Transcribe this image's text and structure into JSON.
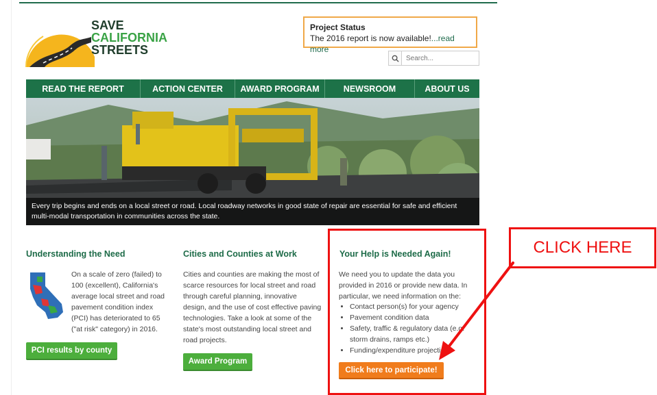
{
  "logo": {
    "line1": "SAVE",
    "line2": "CALIFORNIA",
    "line3": "STREETS"
  },
  "status": {
    "title": "Project Status",
    "text": "The 2016 report is now available!",
    "link": "...read more"
  },
  "search": {
    "placeholder": "Search..."
  },
  "nav": {
    "items": [
      "READ THE REPORT",
      "ACTION CENTER",
      "AWARD PROGRAM",
      "NEWSROOM",
      "ABOUT US"
    ]
  },
  "hero": {
    "caption": "Every trip begins and ends on a local street or road. Local roadway networks in good state of repair are essential for safe and efficient multi-modal transportation in communities across the state."
  },
  "need": {
    "title": "Understanding the Need",
    "text": "On a scale of zero (failed) to 100 (excellent), California's average local street and road pavement condition index (PCI) has deteriorated to 65 (\"at risk\" category) in 2016.",
    "button": "PCI results by county"
  },
  "cities": {
    "title": "Cities and Counties at Work",
    "text": "Cities and counties are making the most of scarce resources for local street and road through careful planning, innovative design, and the use of cost effective paving technologies. Take a look at some of the state's most outstanding local street and road projects.",
    "button": "Award Program"
  },
  "help": {
    "title": "Your Help is Needed Again!",
    "text": "We need you to update the data you provided in 2016 or provide new data. In particular, we need information on the:",
    "items": [
      "Contact person(s) for your agency",
      "Pavement condition data",
      "Safety, traffic & regulatory data (e.g. storm drains, ramps etc.)",
      "Funding/expenditure projections"
    ],
    "button": "Click here to participate!"
  },
  "annotation": {
    "label": "CLICK HERE"
  },
  "colors": {
    "nav_green": "#1d7248",
    "accent_green": "#4cae3c",
    "orange": "#f07c1c",
    "annotation_red": "#e11111"
  }
}
